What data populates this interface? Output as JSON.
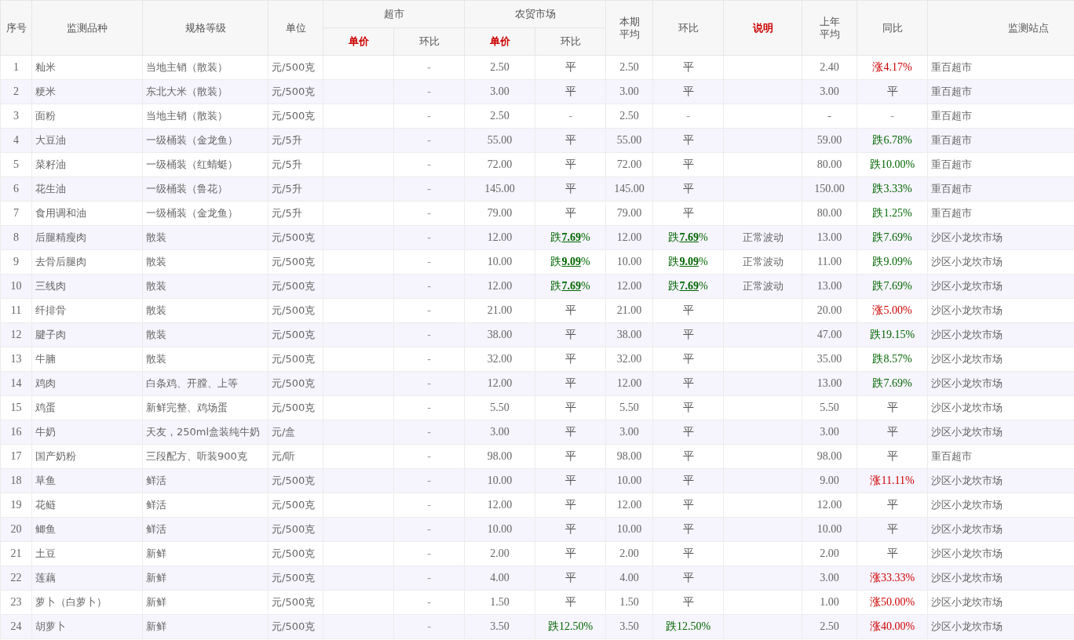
{
  "header": {
    "columns": [
      {
        "label": "序号",
        "highlight": false
      },
      {
        "label": "监测品种",
        "highlight": false
      },
      {
        "label": "规格等级",
        "highlight": false
      },
      {
        "label": "单位",
        "highlight": false
      },
      {
        "label": "超市",
        "highlight": false,
        "sub": [
          {
            "label": "单价",
            "highlight": true
          },
          {
            "label": "环比",
            "highlight": false
          }
        ]
      },
      {
        "label": "农贸市场",
        "highlight": false,
        "sub": [
          {
            "label": "单价",
            "highlight": true
          },
          {
            "label": "环比",
            "highlight": false
          }
        ]
      },
      {
        "lines": [
          "本期",
          "平均"
        ],
        "highlight": false
      },
      {
        "label": "环比",
        "highlight": false
      },
      {
        "label": "说明",
        "highlight": true
      },
      {
        "lines": [
          "上年",
          "平均"
        ],
        "highlight": false
      },
      {
        "label": "同比",
        "highlight": false
      },
      {
        "label": "监测站点",
        "highlight": false
      }
    ]
  },
  "rows": [
    {
      "no": "1",
      "item": "籼米",
      "spec": "当地主销（散装）",
      "unit": "元/500克",
      "super_change": {
        "text": "-",
        "kind": "none"
      },
      "market_price": "2.50",
      "market_change": {
        "text": "平",
        "kind": "flat"
      },
      "avg": "2.50",
      "avg_change": {
        "text": "平",
        "kind": "flat"
      },
      "last_year": "2.40",
      "yoy": {
        "text": "涨4.17%",
        "kind": "up"
      },
      "station": "重百超市"
    },
    {
      "no": "2",
      "item": "粳米",
      "spec": "东北大米（散装）",
      "unit": "元/500克",
      "super_change": {
        "text": "-",
        "kind": "none"
      },
      "market_price": "3.00",
      "market_change": {
        "text": "平",
        "kind": "flat"
      },
      "avg": "3.00",
      "avg_change": {
        "text": "平",
        "kind": "flat"
      },
      "last_year": "3.00",
      "yoy": {
        "text": "平",
        "kind": "flat"
      },
      "station": "重百超市"
    },
    {
      "no": "3",
      "item": "面粉",
      "spec": "当地主销（散装）",
      "unit": "元/500克",
      "super_change": {
        "text": "-",
        "kind": "none"
      },
      "market_price": "2.50",
      "market_change": {
        "text": "-",
        "kind": "none"
      },
      "avg": "2.50",
      "avg_change": {
        "text": "-",
        "kind": "none"
      },
      "last_year": "-",
      "yoy": {
        "text": "-",
        "kind": "none"
      },
      "station": "重百超市"
    },
    {
      "no": "4",
      "item": "大豆油",
      "spec": "一级桶装（金龙鱼）",
      "unit": "元/5升",
      "super_change": {
        "text": "-",
        "kind": "none"
      },
      "market_price": "55.00",
      "market_change": {
        "text": "平",
        "kind": "flat"
      },
      "avg": "55.00",
      "avg_change": {
        "text": "平",
        "kind": "flat"
      },
      "last_year": "59.00",
      "yoy": {
        "text": "跌6.78%",
        "kind": "down"
      },
      "station": "重百超市"
    },
    {
      "no": "5",
      "item": "菜籽油",
      "spec": "一级桶装（红蜻蜓）",
      "unit": "元/5升",
      "super_change": {
        "text": "-",
        "kind": "none"
      },
      "market_price": "72.00",
      "market_change": {
        "text": "平",
        "kind": "flat"
      },
      "avg": "72.00",
      "avg_change": {
        "text": "平",
        "kind": "flat"
      },
      "last_year": "80.00",
      "yoy": {
        "text": "跌10.00%",
        "kind": "down"
      },
      "station": "重百超市"
    },
    {
      "no": "6",
      "item": "花生油",
      "spec": "一级桶装（鲁花）",
      "unit": "元/5升",
      "super_change": {
        "text": "-",
        "kind": "none"
      },
      "market_price": "145.00",
      "market_change": {
        "text": "平",
        "kind": "flat"
      },
      "avg": "145.00",
      "avg_change": {
        "text": "平",
        "kind": "flat"
      },
      "last_year": "150.00",
      "yoy": {
        "text": "跌3.33%",
        "kind": "down"
      },
      "station": "重百超市"
    },
    {
      "no": "7",
      "item": "食用调和油",
      "spec": "一级桶装（金龙鱼）",
      "unit": "元/5升",
      "super_change": {
        "text": "-",
        "kind": "none"
      },
      "market_price": "79.00",
      "market_change": {
        "text": "平",
        "kind": "flat"
      },
      "avg": "79.00",
      "avg_change": {
        "text": "平",
        "kind": "flat"
      },
      "last_year": "80.00",
      "yoy": {
        "text": "跌1.25%",
        "kind": "down"
      },
      "station": "重百超市"
    },
    {
      "no": "8",
      "item": "后腿精瘦肉",
      "spec": "散装",
      "unit": "元/500克",
      "super_change": {
        "text": "-",
        "kind": "none"
      },
      "market_price": "12.00",
      "market_change": {
        "text": "跌**7.69**%",
        "kind": "down"
      },
      "avg": "12.00",
      "avg_change": {
        "text": "跌**7.69**%",
        "kind": "down"
      },
      "note": "正常波动",
      "last_year": "13.00",
      "yoy": {
        "text": "跌7.69%",
        "kind": "down"
      },
      "station": "沙区小龙坎市场"
    },
    {
      "no": "9",
      "item": "去骨后腿肉",
      "spec": "散装",
      "unit": "元/500克",
      "super_change": {
        "text": "-",
        "kind": "none"
      },
      "market_price": "10.00",
      "market_change": {
        "text": "跌**9.09**%",
        "kind": "down"
      },
      "avg": "10.00",
      "avg_change": {
        "text": "跌**9.09**%",
        "kind": "down"
      },
      "note": "正常波动",
      "last_year": "11.00",
      "yoy": {
        "text": "跌9.09%",
        "kind": "down"
      },
      "station": "沙区小龙坎市场"
    },
    {
      "no": "10",
      "item": "三线肉",
      "spec": "散装",
      "unit": "元/500克",
      "super_change": {
        "text": "-",
        "kind": "none"
      },
      "market_price": "12.00",
      "market_change": {
        "text": "跌**7.69**%",
        "kind": "down"
      },
      "avg": "12.00",
      "avg_change": {
        "text": "跌**7.69**%",
        "kind": "down"
      },
      "note": "正常波动",
      "last_year": "13.00",
      "yoy": {
        "text": "跌7.69%",
        "kind": "down"
      },
      "station": "沙区小龙坎市场"
    },
    {
      "no": "11",
      "item": "纤排骨",
      "spec": "散装",
      "unit": "元/500克",
      "super_change": {
        "text": "-",
        "kind": "none"
      },
      "market_price": "21.00",
      "market_change": {
        "text": "平",
        "kind": "flat"
      },
      "avg": "21.00",
      "avg_change": {
        "text": "平",
        "kind": "flat"
      },
      "last_year": "20.00",
      "yoy": {
        "text": "涨5.00%",
        "kind": "up"
      },
      "station": "沙区小龙坎市场"
    },
    {
      "no": "12",
      "item": "腱子肉",
      "spec": "散装",
      "unit": "元/500克",
      "super_change": {
        "text": "-",
        "kind": "none"
      },
      "market_price": "38.00",
      "market_change": {
        "text": "平",
        "kind": "flat"
      },
      "avg": "38.00",
      "avg_change": {
        "text": "平",
        "kind": "flat"
      },
      "last_year": "47.00",
      "yoy": {
        "text": "跌19.15%",
        "kind": "down"
      },
      "station": "沙区小龙坎市场"
    },
    {
      "no": "13",
      "item": "牛腩",
      "spec": "散装",
      "unit": "元/500克",
      "super_change": {
        "text": "-",
        "kind": "none"
      },
      "market_price": "32.00",
      "market_change": {
        "text": "平",
        "kind": "flat"
      },
      "avg": "32.00",
      "avg_change": {
        "text": "平",
        "kind": "flat"
      },
      "last_year": "35.00",
      "yoy": {
        "text": "跌8.57%",
        "kind": "down"
      },
      "station": "沙区小龙坎市场"
    },
    {
      "no": "14",
      "item": "鸡肉",
      "spec": "白条鸡、开膛、上等",
      "unit": "元/500克",
      "super_change": {
        "text": "-",
        "kind": "none"
      },
      "market_price": "12.00",
      "market_change": {
        "text": "平",
        "kind": "flat"
      },
      "avg": "12.00",
      "avg_change": {
        "text": "平",
        "kind": "flat"
      },
      "last_year": "13.00",
      "yoy": {
        "text": "跌7.69%",
        "kind": "down"
      },
      "station": "沙区小龙坎市场"
    },
    {
      "no": "15",
      "item": "鸡蛋",
      "spec": "新鲜完整、鸡场蛋",
      "unit": "元/500克",
      "super_change": {
        "text": "-",
        "kind": "none"
      },
      "market_price": "5.50",
      "market_change": {
        "text": "平",
        "kind": "flat"
      },
      "avg": "5.50",
      "avg_change": {
        "text": "平",
        "kind": "flat"
      },
      "last_year": "5.50",
      "yoy": {
        "text": "平",
        "kind": "flat"
      },
      "station": "沙区小龙坎市场"
    },
    {
      "no": "16",
      "item": "牛奶",
      "spec": "天友，250ml盒装纯牛奶",
      "unit": "元/盒",
      "super_change": {
        "text": "-",
        "kind": "none"
      },
      "market_price": "3.00",
      "market_change": {
        "text": "平",
        "kind": "flat"
      },
      "avg": "3.00",
      "avg_change": {
        "text": "平",
        "kind": "flat"
      },
      "last_year": "3.00",
      "yoy": {
        "text": "平",
        "kind": "flat"
      },
      "station": "沙区小龙坎市场"
    },
    {
      "no": "17",
      "item": "国产奶粉",
      "spec": "三段配方、听装900克",
      "unit": "元/听",
      "super_change": {
        "text": "-",
        "kind": "none"
      },
      "market_price": "98.00",
      "market_change": {
        "text": "平",
        "kind": "flat"
      },
      "avg": "98.00",
      "avg_change": {
        "text": "平",
        "kind": "flat"
      },
      "last_year": "98.00",
      "yoy": {
        "text": "平",
        "kind": "flat"
      },
      "station": "重百超市"
    },
    {
      "no": "18",
      "item": "草鱼",
      "spec": "鲜活",
      "unit": "元/500克",
      "super_change": {
        "text": "-",
        "kind": "none"
      },
      "market_price": "10.00",
      "market_change": {
        "text": "平",
        "kind": "flat"
      },
      "avg": "10.00",
      "avg_change": {
        "text": "平",
        "kind": "flat"
      },
      "last_year": "9.00",
      "yoy": {
        "text": "涨11.11%",
        "kind": "up"
      },
      "station": "沙区小龙坎市场"
    },
    {
      "no": "19",
      "item": "花鲢",
      "spec": "鲜活",
      "unit": "元/500克",
      "super_change": {
        "text": "-",
        "kind": "none"
      },
      "market_price": "12.00",
      "market_change": {
        "text": "平",
        "kind": "flat"
      },
      "avg": "12.00",
      "avg_change": {
        "text": "平",
        "kind": "flat"
      },
      "last_year": "12.00",
      "yoy": {
        "text": "平",
        "kind": "flat"
      },
      "station": "沙区小龙坎市场"
    },
    {
      "no": "20",
      "item": "鲫鱼",
      "spec": "鲜活",
      "unit": "元/500克",
      "super_change": {
        "text": "-",
        "kind": "none"
      },
      "market_price": "10.00",
      "market_change": {
        "text": "平",
        "kind": "flat"
      },
      "avg": "10.00",
      "avg_change": {
        "text": "平",
        "kind": "flat"
      },
      "last_year": "10.00",
      "yoy": {
        "text": "平",
        "kind": "flat"
      },
      "station": "沙区小龙坎市场"
    },
    {
      "no": "21",
      "item": "土豆",
      "spec": "新鲜",
      "unit": "元/500克",
      "super_change": {
        "text": "-",
        "kind": "none"
      },
      "market_price": "2.00",
      "market_change": {
        "text": "平",
        "kind": "flat"
      },
      "avg": "2.00",
      "avg_change": {
        "text": "平",
        "kind": "flat"
      },
      "last_year": "2.00",
      "yoy": {
        "text": "平",
        "kind": "flat"
      },
      "station": "沙区小龙坎市场"
    },
    {
      "no": "22",
      "item": "莲藕",
      "spec": "新鲜",
      "unit": "元/500克",
      "super_change": {
        "text": "-",
        "kind": "none"
      },
      "market_price": "4.00",
      "market_change": {
        "text": "平",
        "kind": "flat"
      },
      "avg": "4.00",
      "avg_change": {
        "text": "平",
        "kind": "flat"
      },
      "last_year": "3.00",
      "yoy": {
        "text": "涨33.33%",
        "kind": "up"
      },
      "station": "沙区小龙坎市场"
    },
    {
      "no": "23",
      "item": "萝卜（白萝卜）",
      "spec": "新鲜",
      "unit": "元/500克",
      "super_change": {
        "text": "-",
        "kind": "none"
      },
      "market_price": "1.50",
      "market_change": {
        "text": "平",
        "kind": "flat"
      },
      "avg": "1.50",
      "avg_change": {
        "text": "平",
        "kind": "flat"
      },
      "last_year": "1.00",
      "yoy": {
        "text": "涨50.00%",
        "kind": "up"
      },
      "station": "沙区小龙坎市场"
    },
    {
      "no": "24",
      "item": "胡萝卜",
      "spec": "新鲜",
      "unit": "元/500克",
      "super_change": {
        "text": "-",
        "kind": "none"
      },
      "market_price": "3.50",
      "market_change": {
        "text": "跌12.50%",
        "kind": "down"
      },
      "avg": "3.50",
      "avg_change": {
        "text": "跌12.50%",
        "kind": "down"
      },
      "last_year": "2.50",
      "yoy": {
        "text": "涨40.00%",
        "kind": "up"
      },
      "station": "沙区小龙坎市场"
    }
  ]
}
